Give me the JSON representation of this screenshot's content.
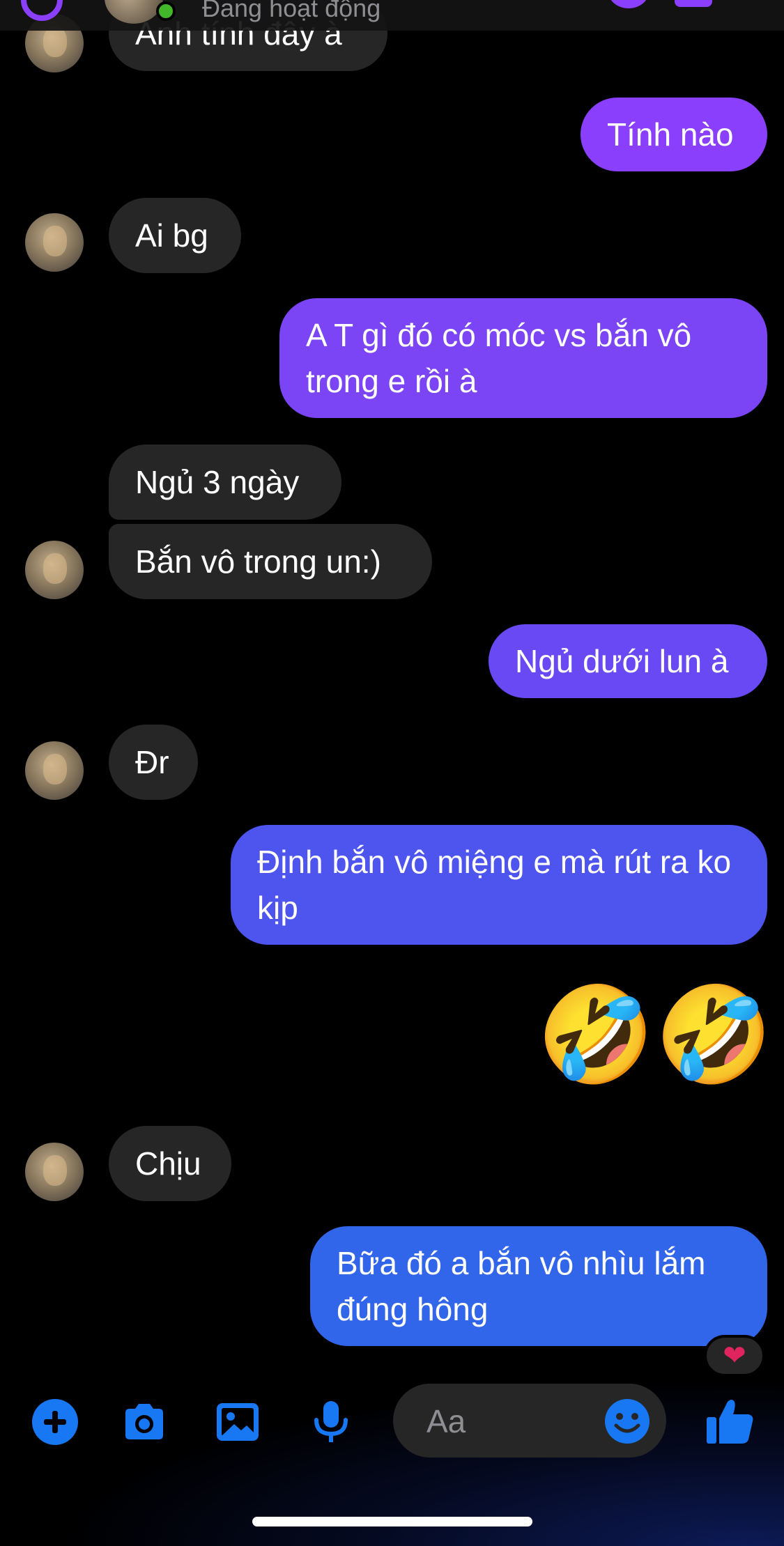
{
  "header": {
    "status": "Đang hoạt động"
  },
  "messages": [
    {
      "dir": "in",
      "text": "Anh tính đây à"
    },
    {
      "dir": "out",
      "text": "Tính nào"
    },
    {
      "dir": "in",
      "text": "Ai bg"
    },
    {
      "dir": "out",
      "text": "A T gì đó có móc vs bắn vô trong e rồi à"
    },
    {
      "dir": "in",
      "text": "Ngủ 3 ngày"
    },
    {
      "dir": "in",
      "text": "Bắn vô trong un:)"
    },
    {
      "dir": "out",
      "text": "Ngủ dưới lun à"
    },
    {
      "dir": "in",
      "text": "Đr"
    },
    {
      "dir": "out",
      "text": "Định bắn vô miệng e mà rút ra ko kịp"
    },
    {
      "dir": "out",
      "text": "🤣🤣"
    },
    {
      "dir": "in",
      "text": "Chịu"
    },
    {
      "dir": "out",
      "text": "Bữa đó a bắn vô nhìu lắm đúng hông"
    }
  ],
  "reaction": {
    "emoji": "❤"
  },
  "composer": {
    "placeholder": "Aa"
  },
  "icons": {
    "toolbar": [
      "plus-icon",
      "camera-icon",
      "image-icon",
      "microphone-icon",
      "smiley-icon",
      "thumbs-up-icon"
    ]
  },
  "colors": {
    "accent": "#1877f2",
    "gradient_top": "#8a3ffc",
    "gradient_bottom": "#2f6bea",
    "incoming_bubble": "#262626"
  }
}
